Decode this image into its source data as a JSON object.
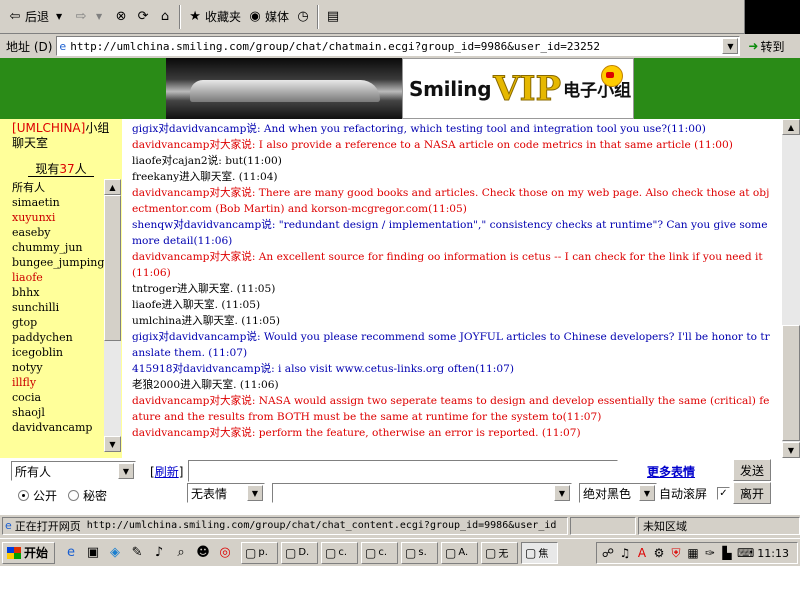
{
  "toolbar": {
    "back_label": "后退",
    "favorites_label": "收藏夹",
    "media_label": "媒体"
  },
  "address": {
    "label": "地址 (D)",
    "url": "http://umlchina.smiling.com/group/chat/chatmain.ecgi?group_id=9986&user_id=23252",
    "go_label": "转到"
  },
  "banner": {
    "brand_smiling": "Smiling",
    "brand_vip": "VIP",
    "brand_group": "电子小组"
  },
  "users_panel": {
    "room_code": "UMLCHINA",
    "room_bracket_open": "[",
    "room_bracket_close": "]",
    "room_suffix": "小组聊天室",
    "online_prefix": "现有",
    "online_count": "37",
    "online_suffix": "人",
    "users": [
      "所有人",
      "simaetin",
      "xuyunxi",
      "easeby",
      "chummy_jun",
      "bungee_jumping",
      "liaofe",
      "bhhx",
      "sunchilli",
      "gtop",
      "paddychen",
      "icegoblin",
      "notyy",
      "illfly",
      "cocia",
      "shaojl",
      "davidvancamp"
    ],
    "user_colors": [
      "#000000",
      "#000000",
      "#cc0000",
      "#000000",
      "#000000",
      "#000000",
      "#cc0000",
      "#000000",
      "#000000",
      "#000000",
      "#000000",
      "#000000",
      "#000000",
      "#cc0000",
      "#000000",
      "#000000",
      "#000000"
    ]
  },
  "chat": {
    "messages": [
      {
        "text": "gigix对davidvancamp说: And when you refactoring, which testing tool and integration tool you use?(11:00)",
        "color": "blue"
      },
      {
        "text": "davidvancamp对大家说: I also provide a reference to a NASA article on code metrics in that same article (11:00)",
        "color": "red"
      },
      {
        "text": "liaofe对cajan2说: but(11:00)",
        "color": "black"
      },
      {
        "text": "freekany进入聊天室. (11:04)",
        "color": "black"
      },
      {
        "text": "davidvancamp对大家说: There are many good books and articles. Check those on my web page. Also check those at objectmentor.com (Bob Martin) and korson-mcgregor.com(11:05)",
        "color": "red"
      },
      {
        "text": "shenqw对davidvancamp说: \"redundant design / implementation\",\" consistency checks at runtime\"? Can you give some more detail(11:06)",
        "color": "blue"
      },
      {
        "text": "davidvancamp对大家说: An excellent source for finding oo information is cetus -- I can check for the link if you need it(11:06)",
        "color": "red"
      },
      {
        "text": "tntroger进入聊天室. (11:05)",
        "color": "black"
      },
      {
        "text": "liaofe进入聊天室. (11:05)",
        "color": "black"
      },
      {
        "text": "umlchina进入聊天室. (11:05)",
        "color": "black"
      },
      {
        "text": "gigix对davidvancamp说: Would you please recommend some JOYFUL articles to Chinese developers? I'll be honor to translate them. (11:07)",
        "color": "blue"
      },
      {
        "text": "415918对davidvancamp说: i also visit www.cetus-links.org often(11:07)",
        "color": "blue"
      },
      {
        "text": "老狼2000进入聊天室. (11:06)",
        "color": "black"
      },
      {
        "text": "davidvancamp对大家说: NASA would assign two seperate teams to design and develop essentially the same (critical) feature and the results from BOTH must be the same at runtime for the system to(11:07)",
        "color": "red"
      },
      {
        "text": "davidvancamp对大家说: perform the feature, otherwise an error is reported. (11:07)",
        "color": "red"
      }
    ]
  },
  "input_area": {
    "target_select": "所有人",
    "refresh_label": "刷新",
    "refresh_bracket_open": "[",
    "refresh_bracket_close": "]",
    "more_faces_label": "更多表情",
    "send_label": "发送",
    "public_label": "公开",
    "private_label": "秘密",
    "emotion_select": "无表情",
    "color_select": "绝对黑色",
    "autoscroll_label": "自动滚屏",
    "leave_label": "离开"
  },
  "statusbar": {
    "status_text": "正在打开网页",
    "status_url": "http://umlchina.smiling.com/group/chat/chat_content.ecgi?group_id=9986&user_id",
    "zone_label": "未知区域"
  },
  "taskbar": {
    "start_label": "开始",
    "tasks": [
      "p.",
      "D.",
      "c.",
      "c.",
      "s.",
      "A.",
      "无",
      "焦"
    ],
    "clock": "11:13"
  },
  "colors": {
    "message_blue": "#0000b0",
    "message_red": "#dd0000",
    "banner_green": "#2a8b17",
    "userlist_bg": "#ffff9a"
  }
}
